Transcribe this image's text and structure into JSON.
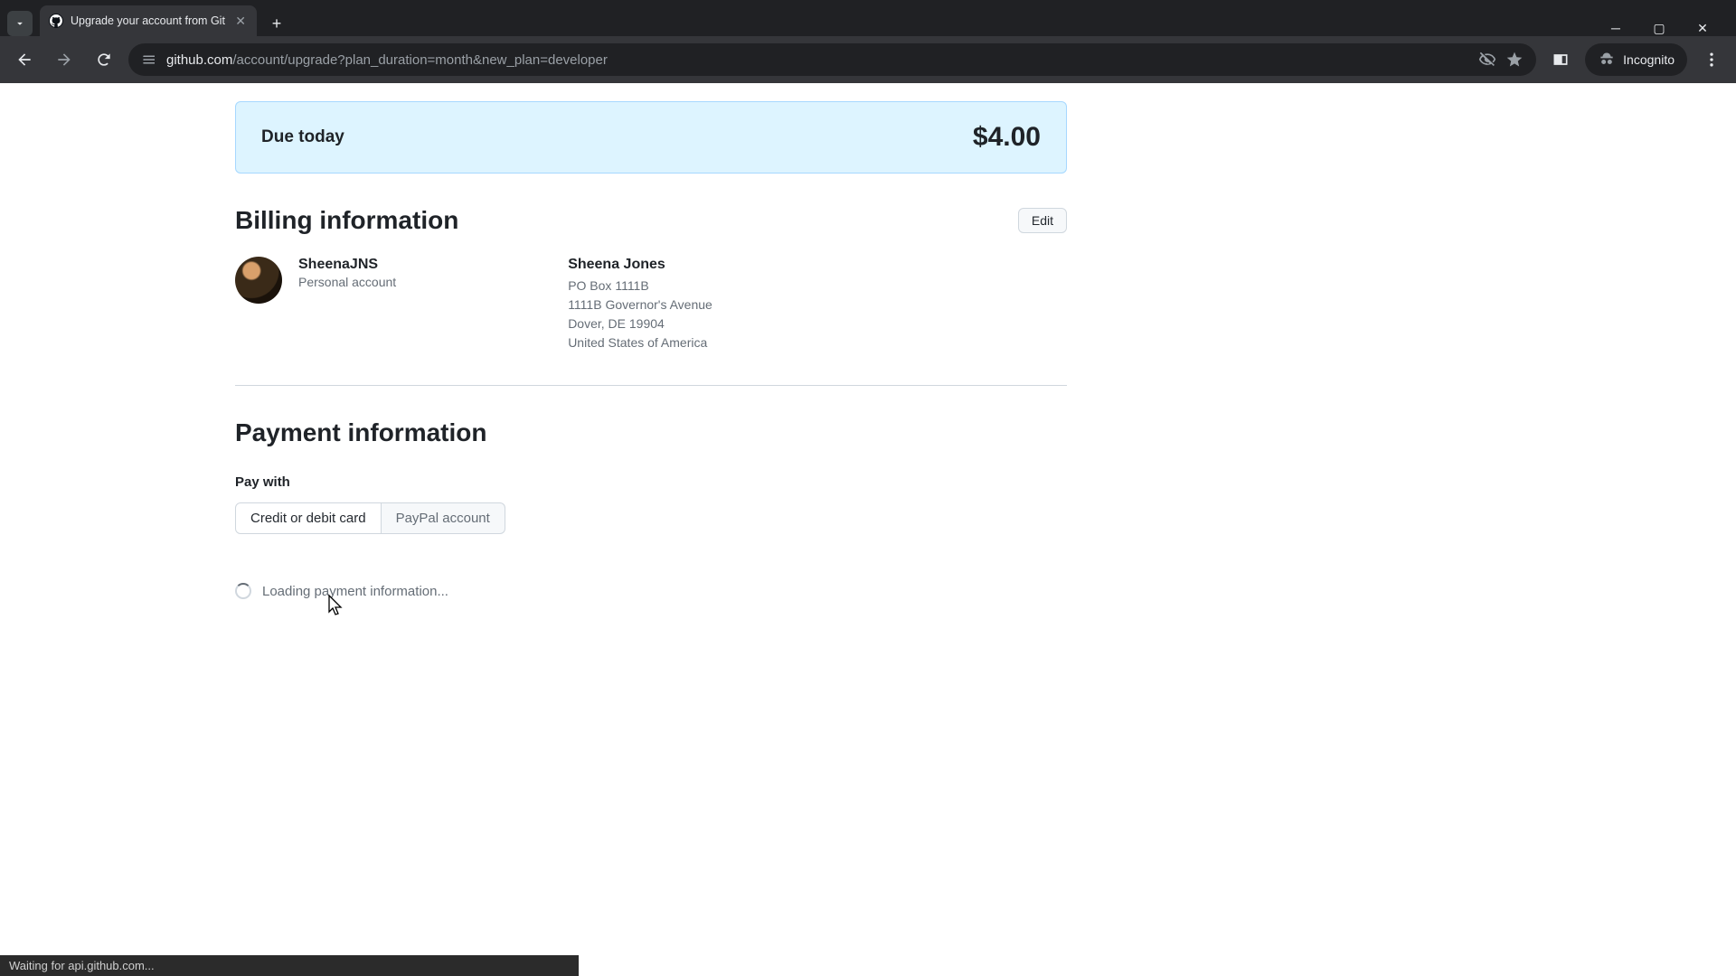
{
  "browser": {
    "tab_title": "Upgrade your account from Git",
    "url_domain": "github.com",
    "url_path": "/account/upgrade?plan_duration=month&new_plan=developer",
    "incognito_label": "Incognito",
    "status_text": "Waiting for api.github.com..."
  },
  "due": {
    "label": "Due today",
    "amount": "$4.00"
  },
  "billing": {
    "heading": "Billing information",
    "edit_label": "Edit",
    "account": {
      "username": "SheenaJNS",
      "type": "Personal account"
    },
    "address": {
      "name": "Sheena Jones",
      "line1": "PO Box 1111B",
      "line2": "1111B Governor's Avenue",
      "line3": "Dover, DE 19904",
      "country": "United States of America"
    }
  },
  "payment": {
    "heading": "Payment information",
    "pay_with_label": "Pay with",
    "option_card": "Credit or debit card",
    "option_paypal": "PayPal account",
    "loading_text": "Loading payment information..."
  }
}
